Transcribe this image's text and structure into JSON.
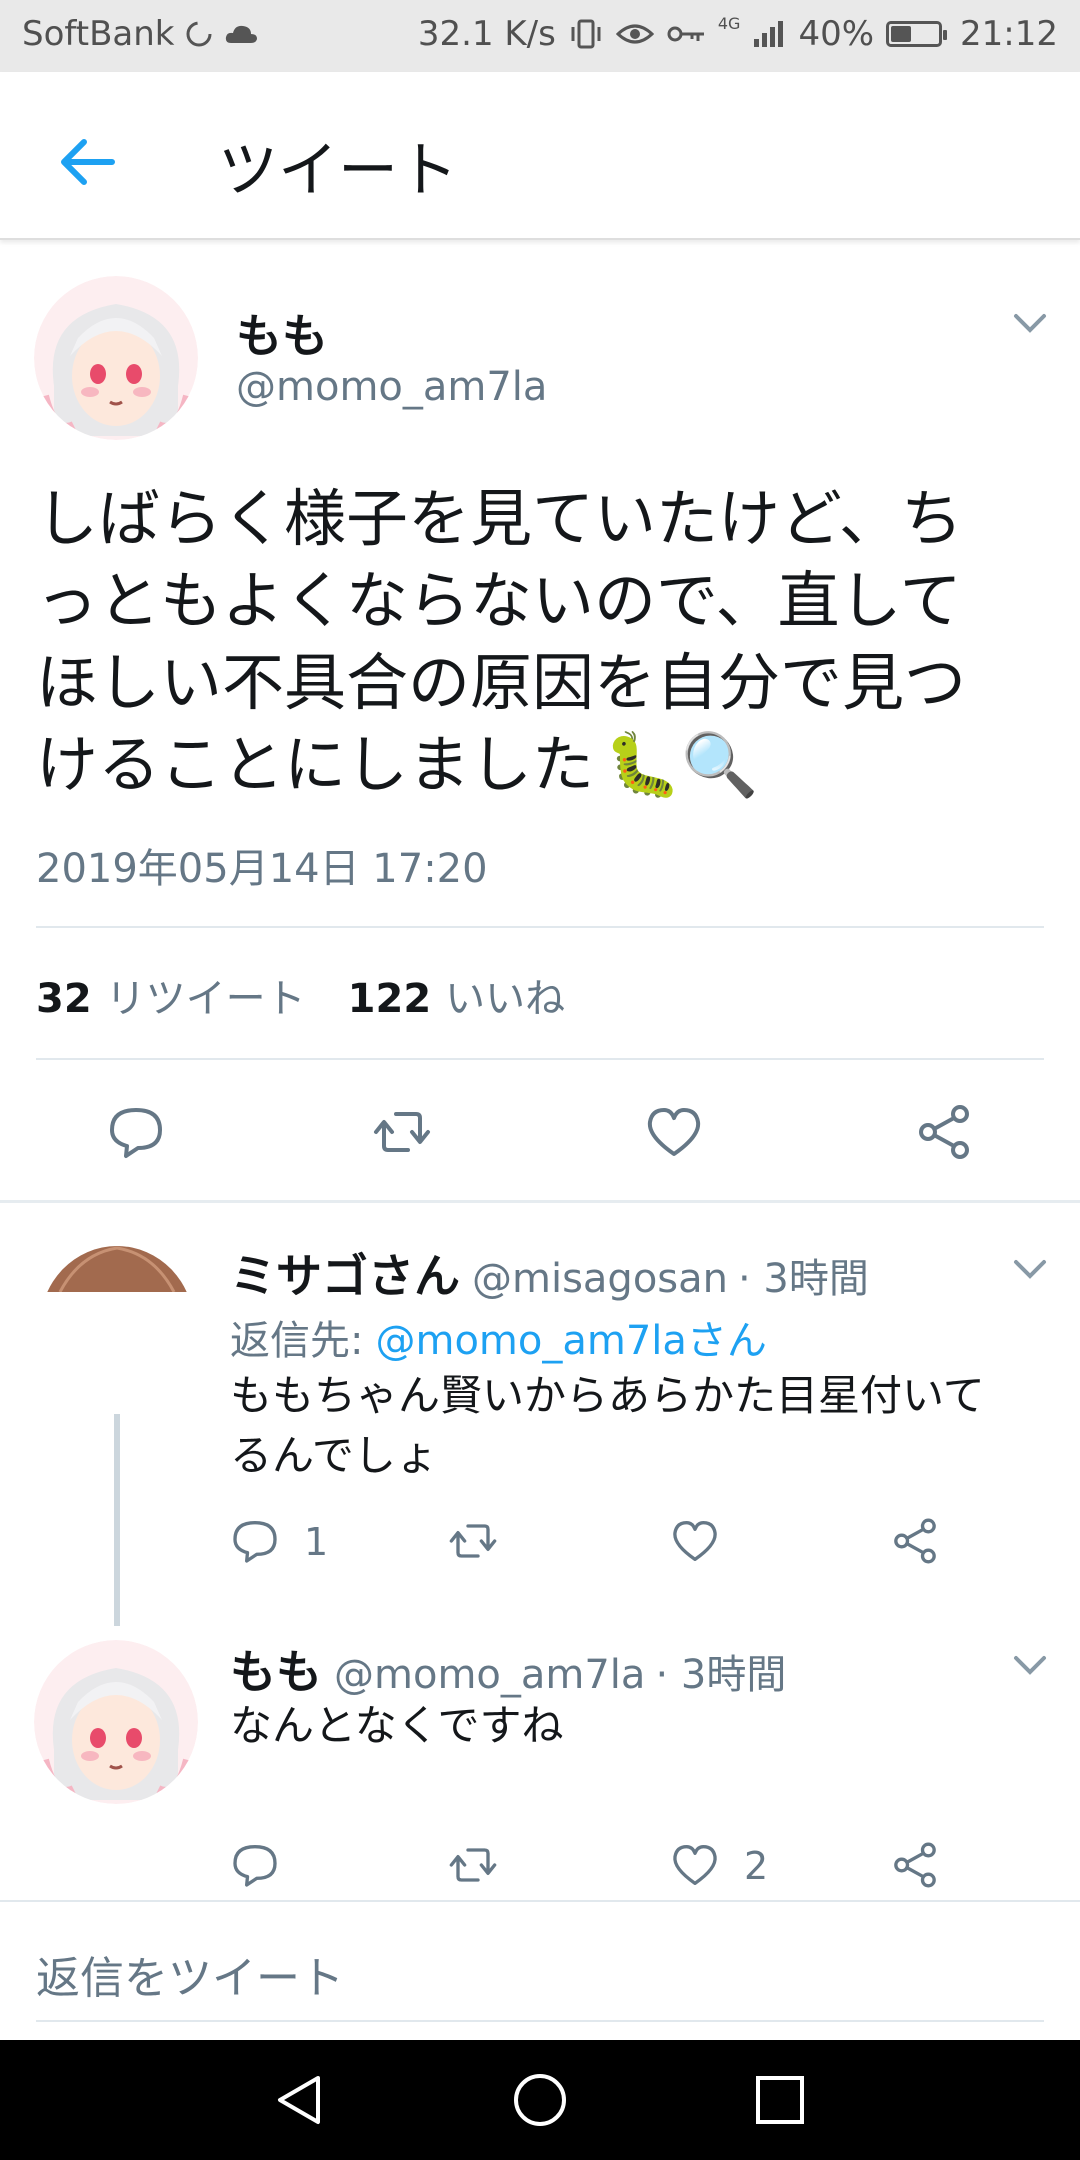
{
  "status_bar": {
    "carrier": "SoftBank",
    "speed": "32.1 K/s",
    "network": "4G",
    "battery": "40%",
    "battery_level": 0.4,
    "time": "21:12"
  },
  "app_bar": {
    "title": "ツイート"
  },
  "main_tweet": {
    "display_name": "もも",
    "handle": "@momo_am7la",
    "text_line1": "しばらく様子を見ていたけど、ち",
    "text_line2": "っともよくならないので、直して",
    "text_line3": "ほしい不具合の原因を自分で見つ",
    "text_line4": "けることにしました",
    "emoji": "🐛🔍",
    "timestamp": "2019年05月14日 17:20",
    "retweet_count": "32",
    "retweet_label": "リツイート",
    "like_count": "122",
    "like_label": "いいね"
  },
  "replies": [
    {
      "display_name": "ミサゴさん",
      "handle": "@misagosan",
      "time": "· 3時間",
      "reply_to_label": "返信先:",
      "reply_to_handle": "@momo_am7laさん",
      "text_line1": "ももちゃん賢いからあらかた目星付いて",
      "text_line2": "るんでしょ",
      "reply_count": "1",
      "retweet_count": "",
      "like_count": ""
    },
    {
      "display_name": "もも",
      "handle": "@momo_am7la",
      "time": "· 3時間",
      "text_line1": "なんとなくですね",
      "reply_count": "",
      "retweet_count": "",
      "like_count": "2"
    }
  ],
  "reply_box": {
    "placeholder": "返信をツイート"
  },
  "colors": {
    "accent": "#1da1f2",
    "text_secondary": "#657786",
    "divider": "#e1e8ed"
  }
}
